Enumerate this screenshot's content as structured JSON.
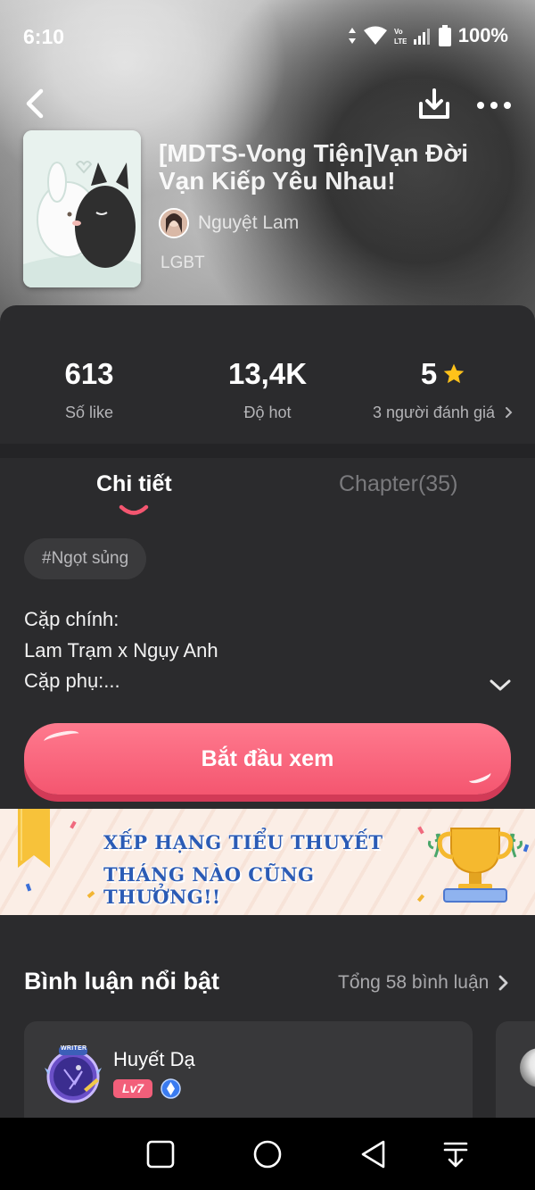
{
  "status_bar": {
    "time": "6:10",
    "battery": "100%",
    "network": "VoLTE"
  },
  "book": {
    "title": "[MDTS-Vong Tiện]Vạn Đời Vạn Kiếp Yêu Nhau!",
    "author": "Nguyệt Lam",
    "genre": "LGBT"
  },
  "stats": {
    "likes_value": "613",
    "likes_label": "Số like",
    "hot_value": "13,4K",
    "hot_label": "Độ hot",
    "rating_value": "5",
    "rating_label": "3 người đánh giá"
  },
  "tabs": {
    "details": "Chi tiết",
    "chapters": "Chapter(35)"
  },
  "tag": "#Ngọt sủng",
  "description": {
    "line1": "Cặp chính:",
    "line2": "Lam Trạm x Ngụy Anh",
    "line3": "Cặp phụ:..."
  },
  "start_button": "Bắt đầu xem",
  "banner": {
    "line1": "XẾP HẠNG TIỂU THUYẾT",
    "line2": "THÁNG NÀO CŨNG THƯỞNG!!"
  },
  "comments": {
    "title": "Bình luận nổi bật",
    "total": "Tổng 58 bình luận",
    "items": [
      {
        "name": "Huyết Dạ",
        "level": "Lv7",
        "frame_label": "WRITER"
      }
    ]
  },
  "colors": {
    "accent": "#f45670",
    "star": "#ffc21a",
    "banner_text": "#2b5bb5",
    "background": "#2b2b2d"
  }
}
